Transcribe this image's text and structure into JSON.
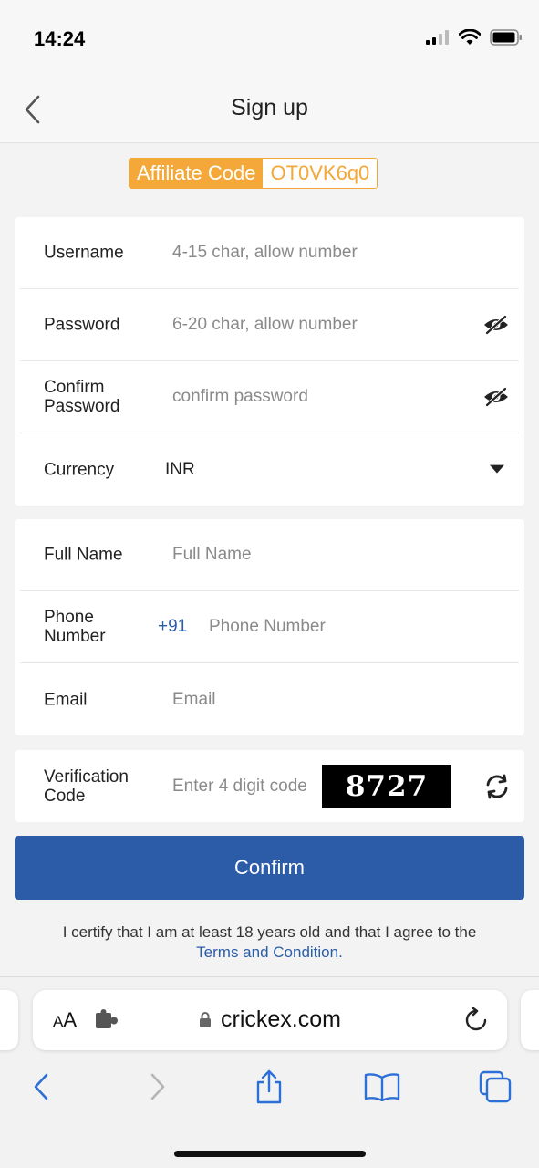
{
  "status_bar": {
    "time": "14:24"
  },
  "header": {
    "title": "Sign up"
  },
  "affiliate": {
    "label": "Affiliate Code",
    "code": "OT0VK6q0"
  },
  "account": {
    "username": {
      "label": "Username",
      "placeholder": "4-15 char, allow number"
    },
    "password": {
      "label": "Password",
      "placeholder": "6-20 char, allow number"
    },
    "confirm_password": {
      "label": "Confirm Password",
      "placeholder": "confirm password"
    },
    "currency": {
      "label": "Currency",
      "value": "INR"
    }
  },
  "personal": {
    "full_name": {
      "label": "Full Name",
      "placeholder": "Full Name"
    },
    "phone": {
      "label": "Phone Number",
      "prefix": "+91",
      "placeholder": "Phone Number"
    },
    "email": {
      "label": "Email",
      "placeholder": "Email"
    }
  },
  "verification": {
    "label": "Verification Code",
    "placeholder": "Enter 4 digit code",
    "captcha": "8727"
  },
  "confirm_label": "Confirm",
  "certify": {
    "text": "I certify that I am at least 18 years old and that I agree to the",
    "link": "Terms and Condition."
  },
  "browser": {
    "url": "crickex.com",
    "aa_large": "A",
    "aa_small": "A"
  },
  "icons": {
    "back": "chevron-left-icon",
    "eye": "eye-off-icon",
    "dropdown": "caret-down-icon",
    "refresh": "refresh-icon",
    "lock": "lock-icon",
    "reload": "reload-icon",
    "share": "share-icon",
    "bookmarks": "book-icon",
    "tabs": "tabs-icon"
  },
  "colors": {
    "accent": "#2c5ca8",
    "affiliate": "#f3a839",
    "link": "#2a5ea9"
  }
}
